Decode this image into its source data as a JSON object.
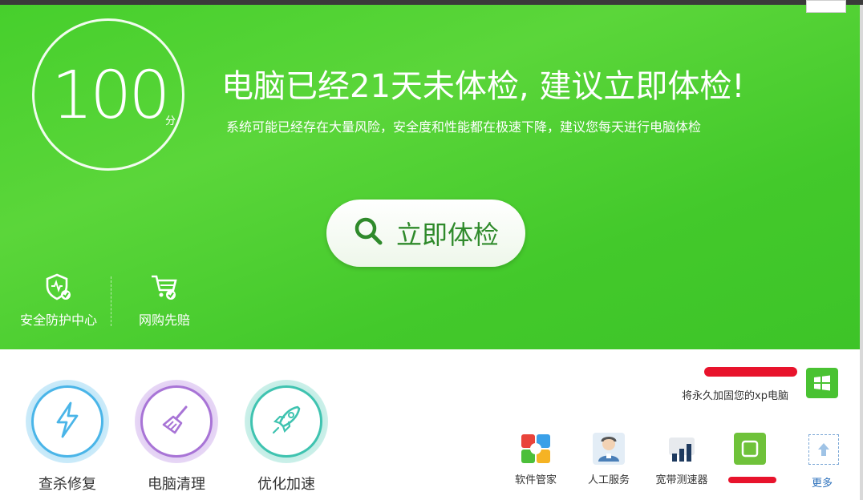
{
  "score": {
    "value": "100",
    "unit": "分"
  },
  "headline": "电脑已经21天未体检, 建议立即体检!",
  "subline": "系统可能已经存在大量风险，安全度和性能都在极速下降，建议您每天进行电脑体检",
  "check_button": {
    "label": "立即体检",
    "icon": "search-icon"
  },
  "hero_shortcuts": [
    {
      "label": "安全防护中心",
      "icon": "shield-check-icon"
    },
    {
      "label": "网购先赔",
      "icon": "cart-check-icon"
    }
  ],
  "tools": [
    {
      "label": "查杀修复",
      "icon": "lightning-icon",
      "color": "#4ab5e8"
    },
    {
      "label": "电脑清理",
      "icon": "broom-icon",
      "color": "#a874d6"
    },
    {
      "label": "优化加速",
      "icon": "rocket-icon",
      "color": "#3fc3b0"
    }
  ],
  "xp_promo": {
    "text": "将永久加固您的xp电脑",
    "icon": "windows-logo-icon"
  },
  "mini_apps": [
    {
      "label": "软件管家",
      "icon": "software-manager-icon"
    },
    {
      "label": "人工服务",
      "icon": "customer-service-icon"
    },
    {
      "label": "宽带测速器",
      "icon": "speed-test-icon"
    },
    {
      "label": "更多",
      "icon": "more-icon"
    }
  ],
  "colors": {
    "hero_green": "#46cf2c",
    "button_text": "#2f8a2b",
    "redaction": "#e8132c",
    "more_link": "#2a6fbb"
  }
}
